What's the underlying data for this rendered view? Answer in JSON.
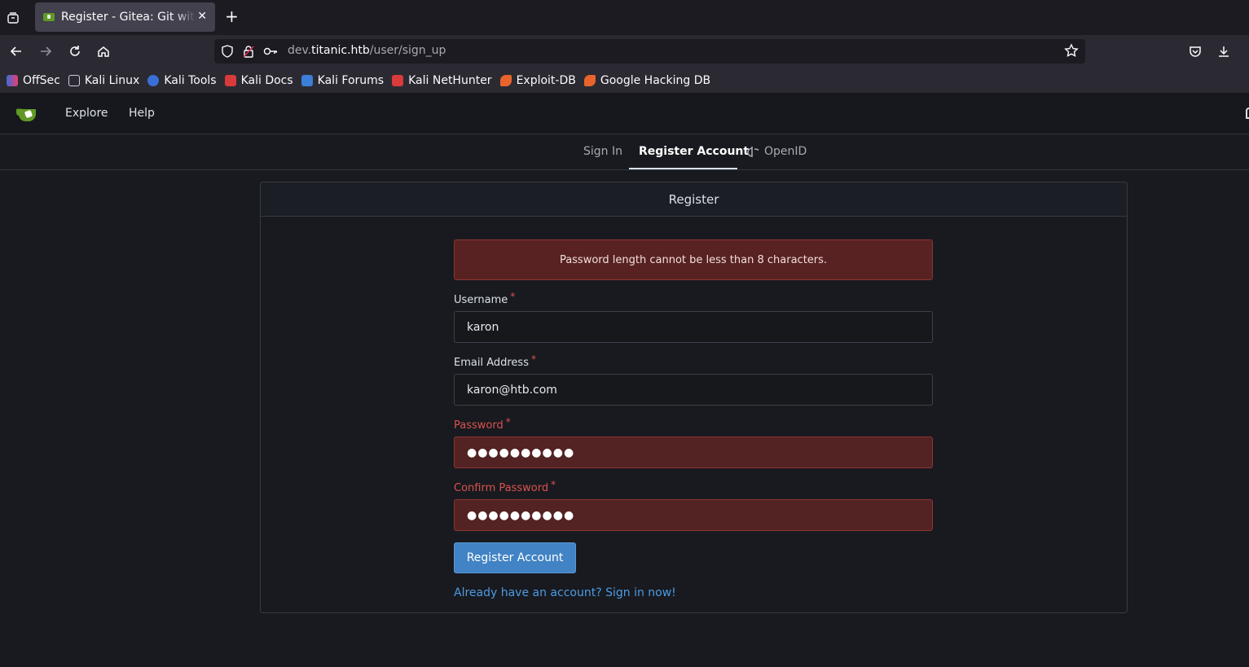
{
  "browser": {
    "tab_title": "Register - Gitea: Git with a cup of tea",
    "url_prefix": "dev.",
    "url_host": "titanic.htb",
    "url_path": "/user/sign_up",
    "bookmarks": [
      {
        "label": "OffSec",
        "color": "#3f6ad8"
      },
      {
        "label": "Kali Linux",
        "color": "#2b2a33"
      },
      {
        "label": "Kali Tools",
        "color": "#3b6ed6"
      },
      {
        "label": "Kali Docs",
        "color": "#d83b3b"
      },
      {
        "label": "Kali Forums",
        "color": "#3b7fd8"
      },
      {
        "label": "Kali NetHunter",
        "color": "#d83b3b"
      },
      {
        "label": "Exploit-DB",
        "color": "#e8642c"
      },
      {
        "label": "Google Hacking DB",
        "color": "#e8642c"
      }
    ]
  },
  "gitea": {
    "nav": {
      "explore": "Explore",
      "help": "Help"
    },
    "tabs": {
      "sign_in": "Sign In",
      "register": "Register Account",
      "openid": "OpenID"
    },
    "card_title": "Register",
    "error": "Password length cannot be less than 8 characters.",
    "fields": {
      "username_label": "Username",
      "username_value": "karon",
      "email_label": "Email Address",
      "email_value": "karon@htb.com",
      "password_label": "Password",
      "password_value": "●●●●●●●●●●",
      "confirm_label": "Confirm Password",
      "confirm_value": "●●●●●●●●●●",
      "required_mark": "*"
    },
    "submit": "Register Account",
    "signin_link": "Already have an account? Sign in now!"
  },
  "colors": {
    "accent": "#4183c4",
    "error_bg": "#582222",
    "brand": "#609926"
  }
}
